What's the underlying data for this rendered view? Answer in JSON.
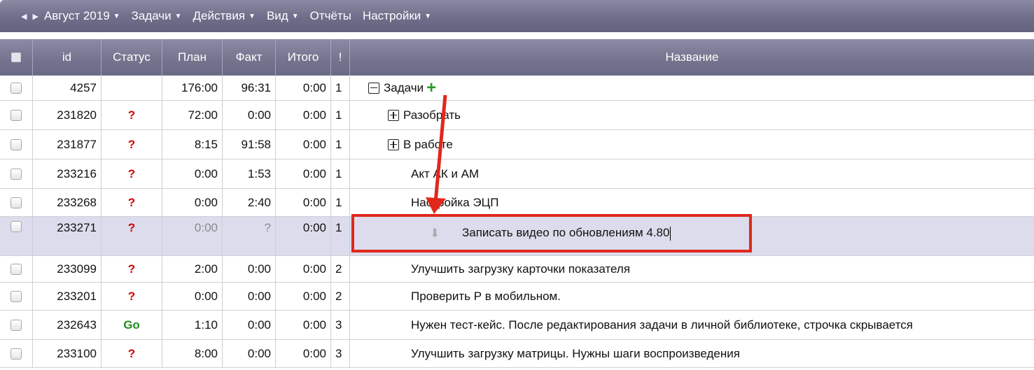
{
  "menubar": {
    "items": [
      {
        "label": "Август 2019",
        "has_caret": true
      },
      {
        "label": "Задачи",
        "has_caret": true
      },
      {
        "label": "Действия",
        "has_caret": true
      },
      {
        "label": "Вид",
        "has_caret": true
      },
      {
        "label": "Отчёты",
        "has_caret": false
      },
      {
        "label": "Настройки",
        "has_caret": true
      }
    ]
  },
  "header": {
    "id": "id",
    "status": "Статус",
    "plan": "План",
    "fact": "Факт",
    "total": "Итого",
    "priority": "!",
    "name": "Название"
  },
  "rows": [
    {
      "id": "4257",
      "status": "",
      "plan": "176:00",
      "fact": "96:31",
      "total": "0:00",
      "priority": "1",
      "name": "Задачи",
      "toggle": "minus",
      "add": true
    },
    {
      "id": "231820",
      "status": "?",
      "plan": "72:00",
      "fact": "0:00",
      "total": "0:00",
      "priority": "1",
      "name": "Разобрать",
      "toggle": "plus"
    },
    {
      "id": "231877",
      "status": "?",
      "plan": "8:15",
      "fact": "91:58",
      "total": "0:00",
      "priority": "1",
      "name": "В работе",
      "toggle": "plus"
    },
    {
      "id": "233216",
      "status": "?",
      "plan": "0:00",
      "fact": "1:53",
      "total": "0:00",
      "priority": "1",
      "name": "Акт АК и АМ"
    },
    {
      "id": "233268",
      "status": "?",
      "plan": "0:00",
      "fact": "2:40",
      "total": "0:00",
      "priority": "1",
      "name": "Настройка ЭЦП"
    },
    {
      "id": "233271",
      "status": "?",
      "plan": "0:00",
      "fact": "?",
      "total": "0:00",
      "priority": "1",
      "name": "Записать видео по обновлениям 4.80",
      "editing": true
    },
    {
      "id": "233099",
      "status": "?",
      "plan": "2:00",
      "fact": "0:00",
      "total": "0:00",
      "priority": "2",
      "name": "Улучшить загрузку карточки показателя"
    },
    {
      "id": "233201",
      "status": "?",
      "plan": "0:00",
      "fact": "0:00",
      "total": "0:00",
      "priority": "2",
      "name": "Проверить Р в мобильном."
    },
    {
      "id": "232643",
      "status": "Go",
      "plan": "1:10",
      "fact": "0:00",
      "total": "0:00",
      "priority": "3",
      "name": "Нужен тест-кейс. После редактирования задачи в личной библиотеке, строчка скрывается"
    },
    {
      "id": "233100",
      "status": "?",
      "plan": "8:00",
      "fact": "0:00",
      "total": "0:00",
      "priority": "3",
      "name": "Улучшить загрузку матрицы. Нужны шаги воспроизведения"
    }
  ],
  "icons": {
    "nav_prev": "triangle-left-icon",
    "nav_next": "triangle-right-icon",
    "add": "plus-icon",
    "drag": "down-arrow-icon"
  },
  "colors": {
    "status_unknown": "#d00000",
    "status_go": "#1f8f1f",
    "highlight_box": "#e0281c",
    "annotation_arrow": "#e0281c"
  }
}
